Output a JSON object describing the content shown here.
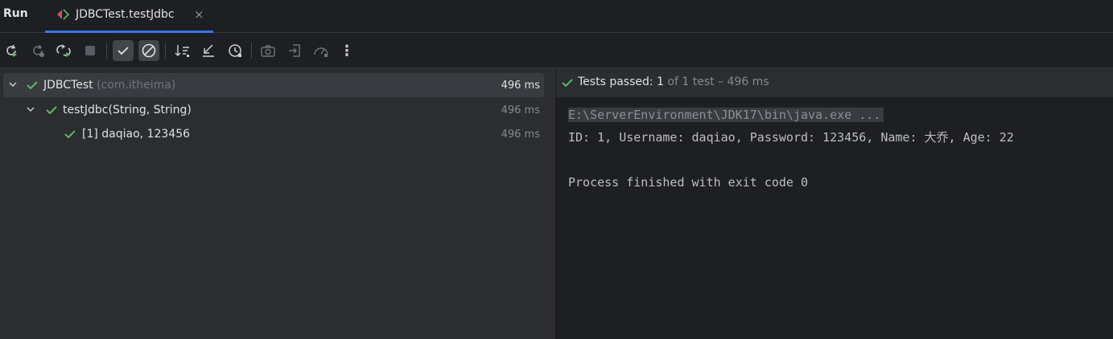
{
  "window": {
    "run_title": "Run",
    "tab_label": "JDBCTest.testJdbc",
    "tab_close": "×"
  },
  "toolbar": {
    "buttons": [
      {
        "name": "rerun-icon",
        "enabled": true
      },
      {
        "name": "rerun-failed-icon",
        "enabled": false
      },
      {
        "name": "toggle-auto-test-icon",
        "enabled": true
      },
      {
        "name": "stop-icon",
        "enabled": false
      },
      {
        "name": "show-passed-icon",
        "toggled": true
      },
      {
        "name": "show-ignored-icon",
        "toggled": true
      },
      {
        "name": "sort-alphabetically-icon",
        "enabled": true
      },
      {
        "name": "import-tests-icon",
        "enabled": true
      },
      {
        "name": "test-history-icon",
        "enabled": true
      },
      {
        "name": "camera-icon",
        "enabled": false
      },
      {
        "name": "export-icon",
        "enabled": false
      },
      {
        "name": "coverage-icon",
        "enabled": false
      },
      {
        "name": "more-options-icon",
        "enabled": true
      }
    ],
    "more_label": "⋮"
  },
  "tree": [
    {
      "label": "JDBCTest",
      "pkg": "(com.itheima)",
      "time": "496 ms",
      "selected": true,
      "level": 0
    },
    {
      "label": "testJdbc(String, String)",
      "pkg": "",
      "time": "496 ms",
      "selected": false,
      "level": 1
    },
    {
      "label": "[1] daqiao, 123456",
      "pkg": "",
      "time": "496 ms",
      "selected": false,
      "level": 2
    }
  ],
  "status": {
    "label": "Tests passed:",
    "count": "1",
    "detail": "of 1 test – 496 ms"
  },
  "console": {
    "cmd": "E:\\ServerEnvironment\\JDK17\\bin\\java.exe ...",
    "lines": [
      "ID: 1, Username: daqiao, Password: 123456, Name: 大乔, Age: 22",
      "",
      "Process finished with exit code 0"
    ]
  },
  "colors": {
    "accent": "#3574f0",
    "success": "#5fb865",
    "background": "#1e1f22",
    "panel": "#2b2d30"
  }
}
